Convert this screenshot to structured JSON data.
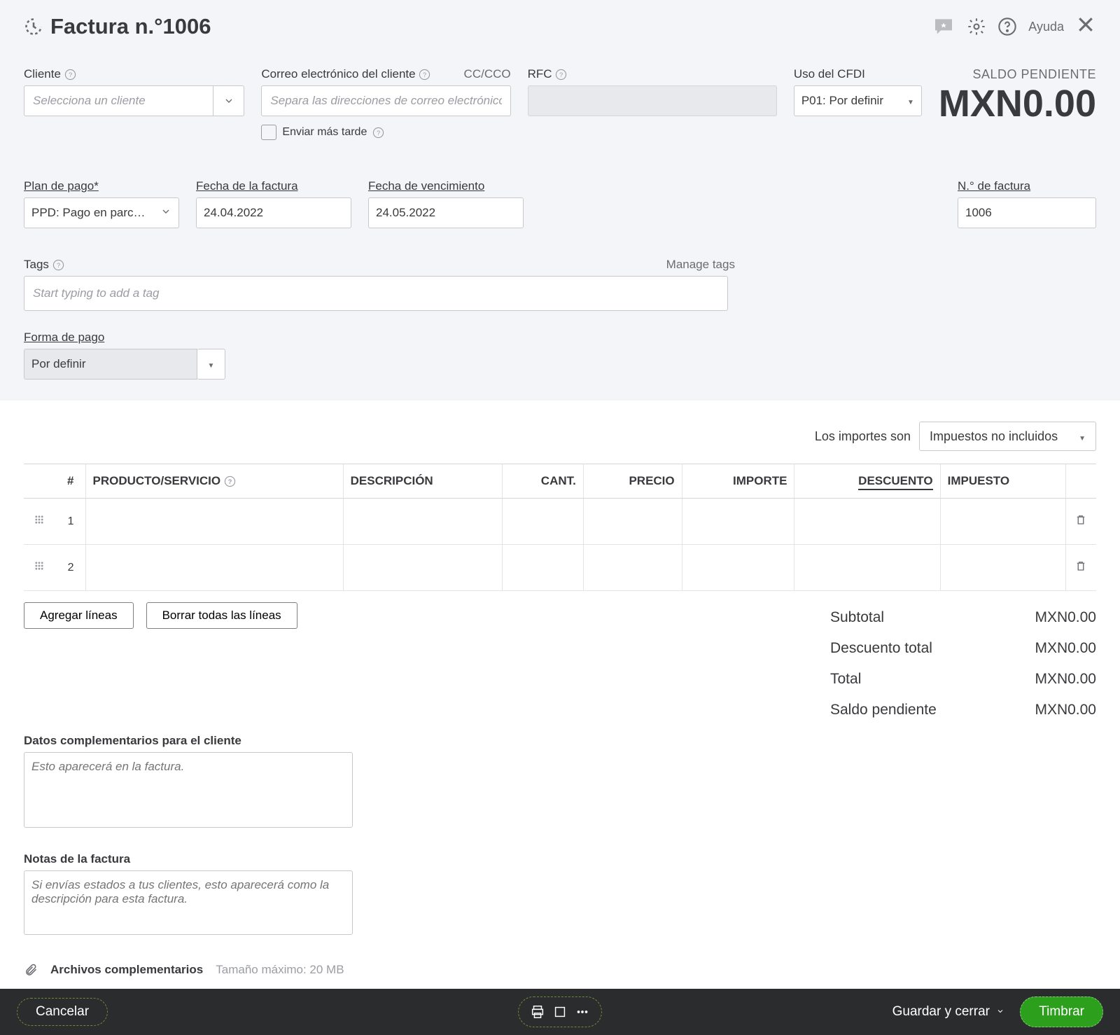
{
  "header": {
    "title": "Factura n.°1006",
    "help_label": "Ayuda"
  },
  "balance": {
    "label": "SALDO PENDIENTE",
    "amount": "MXN0.00"
  },
  "fields": {
    "cliente_label": "Cliente",
    "cliente_placeholder": "Selecciona un cliente",
    "correo_label": "Correo electrónico del cliente",
    "cccco_label": "CC/CCO",
    "correo_placeholder": "Separa las direcciones de correo electrónico",
    "enviar_label": "Enviar más tarde",
    "rfc_label": "RFC",
    "cfdi_label": "Uso del CFDI",
    "cfdi_value": "P01: Por definir",
    "plan_label": "Plan de pago*",
    "plan_value": "PPD: Pago en parc…",
    "fecha_label": "Fecha de la factura",
    "fecha_value": "24.04.2022",
    "venc_label": "Fecha de vencimiento",
    "venc_value": "24.05.2022",
    "num_label": "N.° de factura",
    "num_value": "1006",
    "tags_label": "Tags",
    "manage_tags": "Manage tags",
    "tags_placeholder": "Start typing to add a tag",
    "forma_label": "Forma de pago",
    "forma_value": "Por definir"
  },
  "importes": {
    "label": "Los importes son",
    "value": "Impuestos no incluidos"
  },
  "table": {
    "headers": {
      "hash": "#",
      "product": "PRODUCTO/SERVICIO",
      "desc": "DESCRIPCIÓN",
      "qty": "CANT.",
      "price": "PRECIO",
      "amount": "IMPORTE",
      "discount": "DESCUENTO",
      "tax": "IMPUESTO"
    },
    "rows": [
      {
        "n": "1"
      },
      {
        "n": "2"
      }
    ]
  },
  "buttons": {
    "add_lines": "Agregar líneas",
    "clear_lines": "Borrar todas las líneas"
  },
  "totals": {
    "subtotal_label": "Subtotal",
    "subtotal_value": "MXN0.00",
    "discount_label": "Descuento total",
    "discount_value": "MXN0.00",
    "total_label": "Total",
    "total_value": "MXN0.00",
    "balance_label": "Saldo pendiente",
    "balance_value": "MXN0.00"
  },
  "memo": {
    "client_label": "Datos complementarios para el cliente",
    "client_placeholder": "Esto aparecerá en la factura.",
    "notes_label": "Notas de la factura",
    "notes_placeholder": "Si envías estados a tus clientes, esto aparecerá como la descripción para esta factura."
  },
  "attach": {
    "label": "Archivos complementarios",
    "size": "Tamaño máximo: 20 MB"
  },
  "footer": {
    "cancel": "Cancelar",
    "save_close": "Guardar y cerrar",
    "timbrar": "Timbrar"
  }
}
